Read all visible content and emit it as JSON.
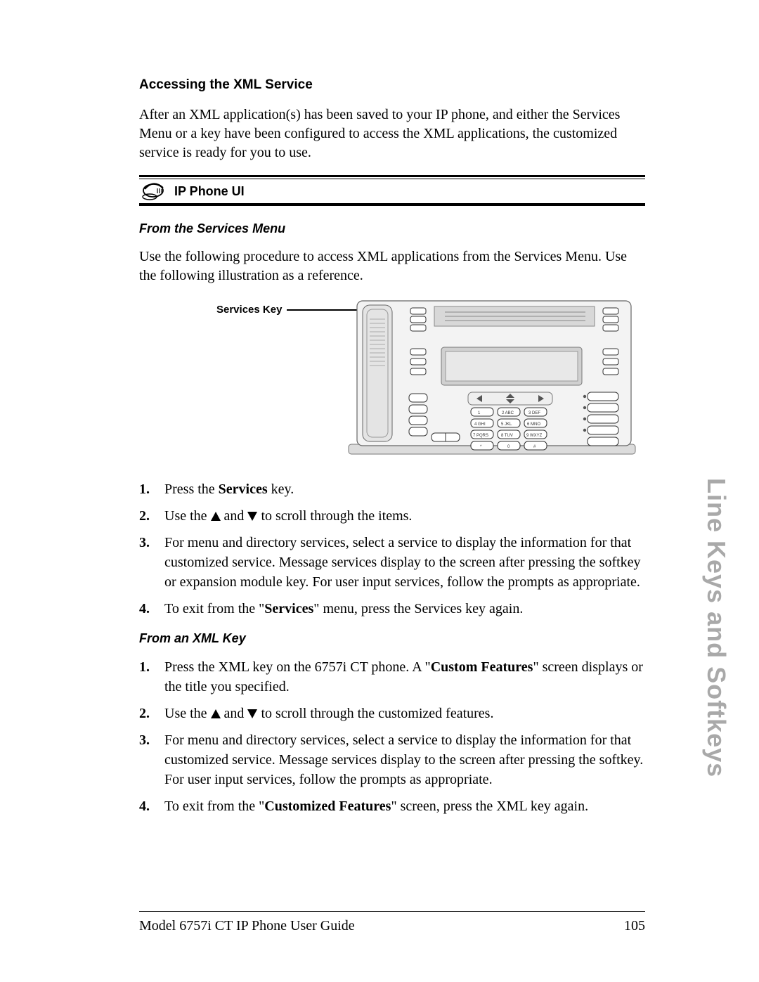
{
  "section_title": "Accessing the XML Service",
  "intro": "After an XML application(s) has been saved to your IP phone, and either the Services Menu or a key have been configured to access the XML applications, the customized service is ready for you to use.",
  "callout_label": "IP Phone UI",
  "sub1_title": "From the Services Menu",
  "sub1_intro": "Use the following procedure to access XML applications from the Services Menu. Use the following illustration as a reference.",
  "figure_label": "Services Key",
  "steps_a": {
    "s1_a": "Press the ",
    "s1_b": "Services",
    "s1_c": " key.",
    "s2_a": "Use the ",
    "s2_b": " and ",
    "s2_c": " to scroll through the items.",
    "s3": "For menu and directory services, select a service to display the information for that customized service. Message services display to the screen after pressing the softkey or expansion module key. For user input services, follow the prompts as appropriate.",
    "s4_a": "To exit from the \"",
    "s4_b": "Services",
    "s4_c": "\" menu, press the Services key again."
  },
  "sub2_title": "From an XML Key",
  "steps_b": {
    "s1_a": "Press the XML key on the 6757i CT phone. A \"",
    "s1_b": "Custom Features",
    "s1_c": "\" screen displays or the title you specified.",
    "s2_a": "Use the ",
    "s2_b": " and ",
    "s2_c": " to scroll through the customized features.",
    "s3": "For menu and directory services, select a service to display the information for that customized service. Message services display to the screen after pressing the softkey. For user input services, follow the prompts as appropriate.",
    "s4_a": "To exit from the \"",
    "s4_b": "Customized Features",
    "s4_c": "\" screen, press the XML key again."
  },
  "side_tab": "Line Keys and Softkeys",
  "footer_left": "Model 6757i CT IP Phone User Guide",
  "footer_right": "105",
  "list_numbers": {
    "n1": "1.",
    "n2": "2.",
    "n3": "3.",
    "n4": "4."
  }
}
